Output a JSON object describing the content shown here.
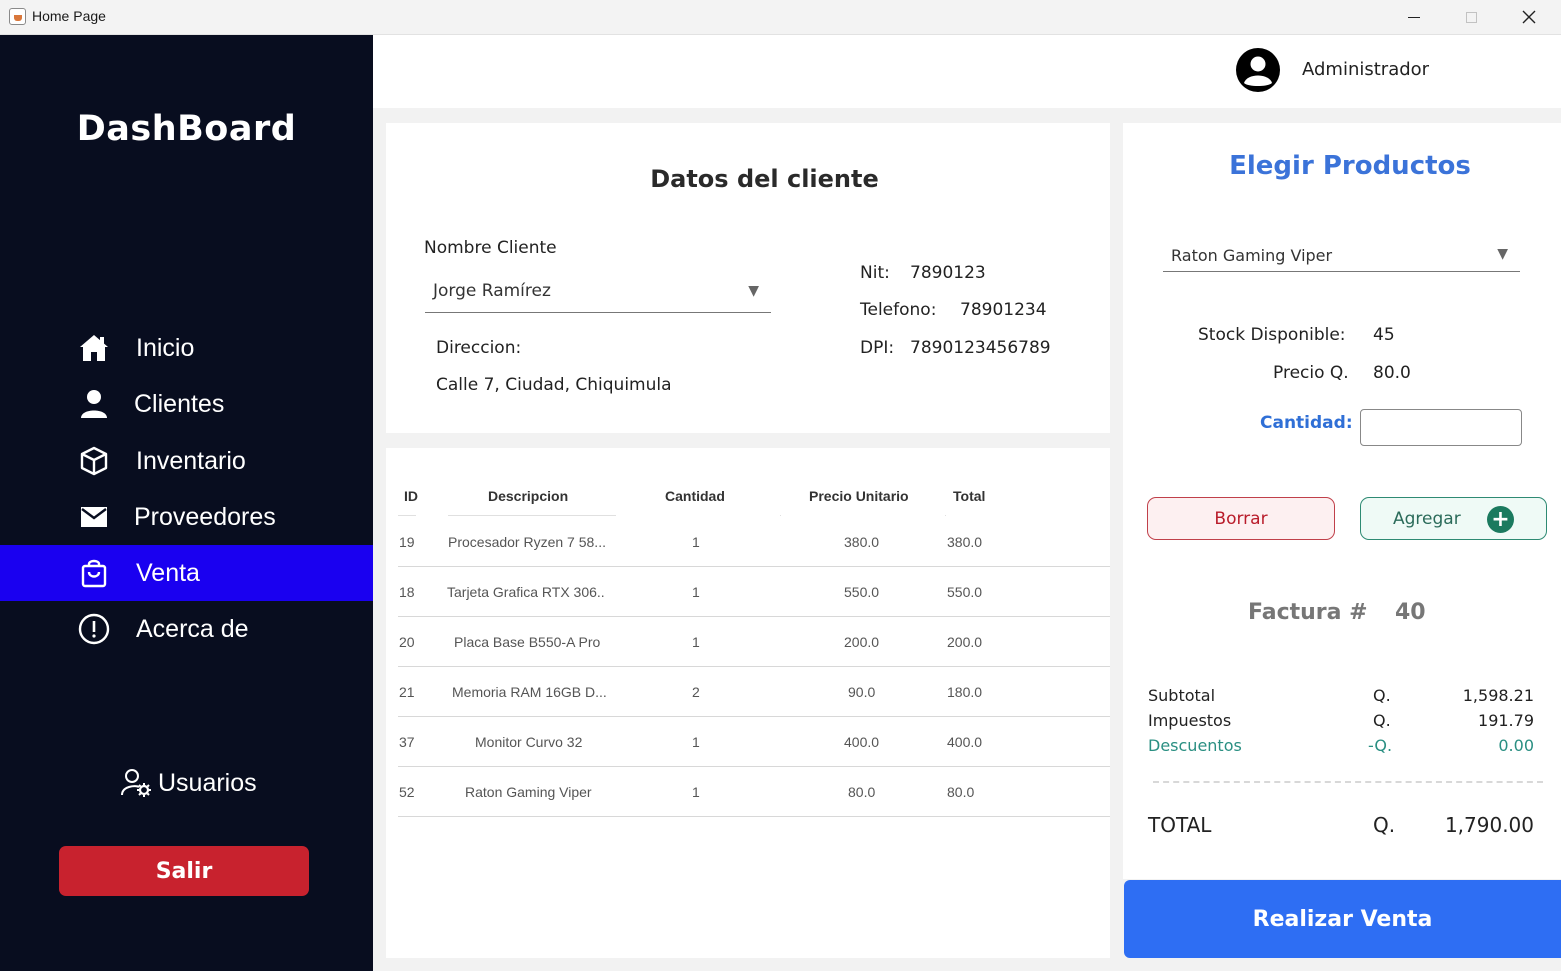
{
  "window": {
    "title": "Home Page"
  },
  "sidebar": {
    "title": "DashBoard",
    "items": [
      {
        "label": "Inicio",
        "icon": "home-icon"
      },
      {
        "label": "Clientes",
        "icon": "user-icon"
      },
      {
        "label": "Inventario",
        "icon": "box-icon"
      },
      {
        "label": "Proveedores",
        "icon": "mail-icon"
      },
      {
        "label": "Venta",
        "icon": "shopping-bag-icon",
        "active": true
      },
      {
        "label": "Acerca de",
        "icon": "info-circle-icon"
      }
    ],
    "users_label": "Usuarios",
    "logout_label": "Salir"
  },
  "header": {
    "user_name": "Administrador"
  },
  "client": {
    "title": "Datos del cliente",
    "name_label": "Nombre Cliente",
    "name_value": "Jorge Ramírez",
    "address_label": "Direccion:",
    "address_value": "Calle 7, Ciudad, Chiquimula",
    "nit_label": "Nit:",
    "nit_value": "7890123",
    "phone_label": "Telefono:",
    "phone_value": "78901234",
    "dpi_label": "DPI:",
    "dpi_value": "7890123456789"
  },
  "table": {
    "columns": [
      "ID",
      "Descripcion",
      "Cantidad",
      "Precio Unitario",
      "Total"
    ],
    "rows": [
      {
        "id": "19",
        "desc": "Procesador Ryzen 7 58...",
        "qty": "1",
        "price": "380.0",
        "total": "380.0"
      },
      {
        "id": "18",
        "desc": "Tarjeta Grafica RTX 306..",
        "qty": "1",
        "price": "550.0",
        "total": "550.0"
      },
      {
        "id": "20",
        "desc": "Placa Base B550-A Pro",
        "qty": "1",
        "price": "200.0",
        "total": "200.0"
      },
      {
        "id": "21",
        "desc": "Memoria RAM 16GB D...",
        "qty": "2",
        "price": "90.0",
        "total": "180.0"
      },
      {
        "id": "37",
        "desc": "Monitor Curvo 32",
        "qty": "1",
        "price": "400.0",
        "total": "400.0"
      },
      {
        "id": "52",
        "desc": "Raton Gaming Viper",
        "qty": "1",
        "price": "80.0",
        "total": "80.0"
      }
    ]
  },
  "products": {
    "title": "Elegir Productos",
    "selected": "Raton Gaming Viper",
    "stock_label": "Stock Disponible:",
    "stock_value": "45",
    "price_label": "Precio Q.",
    "price_value": "80.0",
    "qty_label": "Cantidad:",
    "qty_value": "",
    "delete_label": "Borrar",
    "add_label": "Agregar"
  },
  "invoice": {
    "label": "Factura #",
    "number": "40",
    "subtotal_label": "Subtotal",
    "subtotal_currency": "Q.",
    "subtotal_value": "1,598.21",
    "tax_label": "Impuestos",
    "tax_currency": "Q.",
    "tax_value": "191.79",
    "discount_label": "Descuentos",
    "discount_currency": "-Q.",
    "discount_value": "0.00",
    "total_label": "TOTAL",
    "total_currency": "Q.",
    "total_value": "1,790.00",
    "submit_label": "Realizar Venta"
  },
  "colors": {
    "sidebar_bg": "#080d1f",
    "active_item": "#1a00f0",
    "accent_blue": "#2e6ef3",
    "logout_red": "#c8222e",
    "discount_teal": "#2a8f82"
  }
}
